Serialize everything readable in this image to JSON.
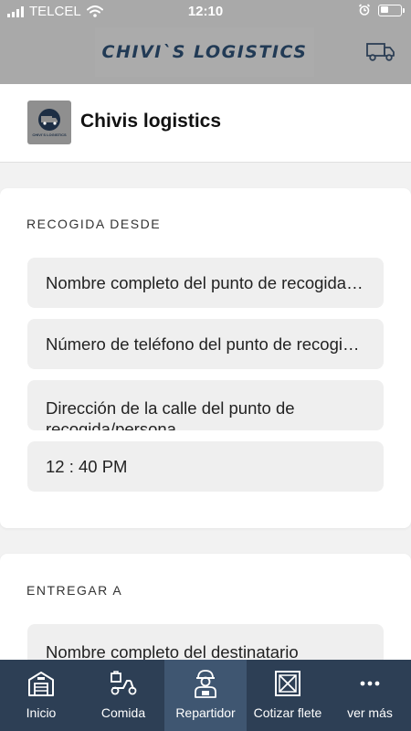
{
  "status_bar": {
    "carrier": "TELCEL",
    "time": "12:10"
  },
  "header": {
    "brand_text": "CHIVI`S LOGISTICS",
    "logo_text": "CHIVI`S LOGISTICS",
    "title": "Chivis logistics"
  },
  "pickup": {
    "section_label": "RECOGIDA DESDE",
    "fields": [
      {
        "placeholder": "Nombre completo del punto de recogida/persona"
      },
      {
        "placeholder": "Número de teléfono del punto de recogida/persona"
      },
      {
        "placeholder": "Dirección de la calle del punto de recogida/persona"
      },
      {
        "value": "12 : 40 PM"
      }
    ]
  },
  "delivery": {
    "section_label": "ENTREGAR A",
    "fields": [
      {
        "placeholder": "Nombre completo del destinatario"
      }
    ]
  },
  "tabs": [
    {
      "label": "Inicio",
      "icon": "warehouse-icon"
    },
    {
      "label": "Comida",
      "icon": "scooter-icon"
    },
    {
      "label": "Repartidor",
      "icon": "delivery-person-icon",
      "active": true
    },
    {
      "label": "Cotizar flete",
      "icon": "crate-icon"
    },
    {
      "label": "ver más",
      "icon": "more-icon"
    }
  ],
  "colors": {
    "header_bg": "#a9a9a9",
    "brand_text": "#213a55",
    "tabbar_bg": "#2d3f55",
    "tab_active_bg": "#3f5671",
    "field_bg": "#efefef"
  }
}
